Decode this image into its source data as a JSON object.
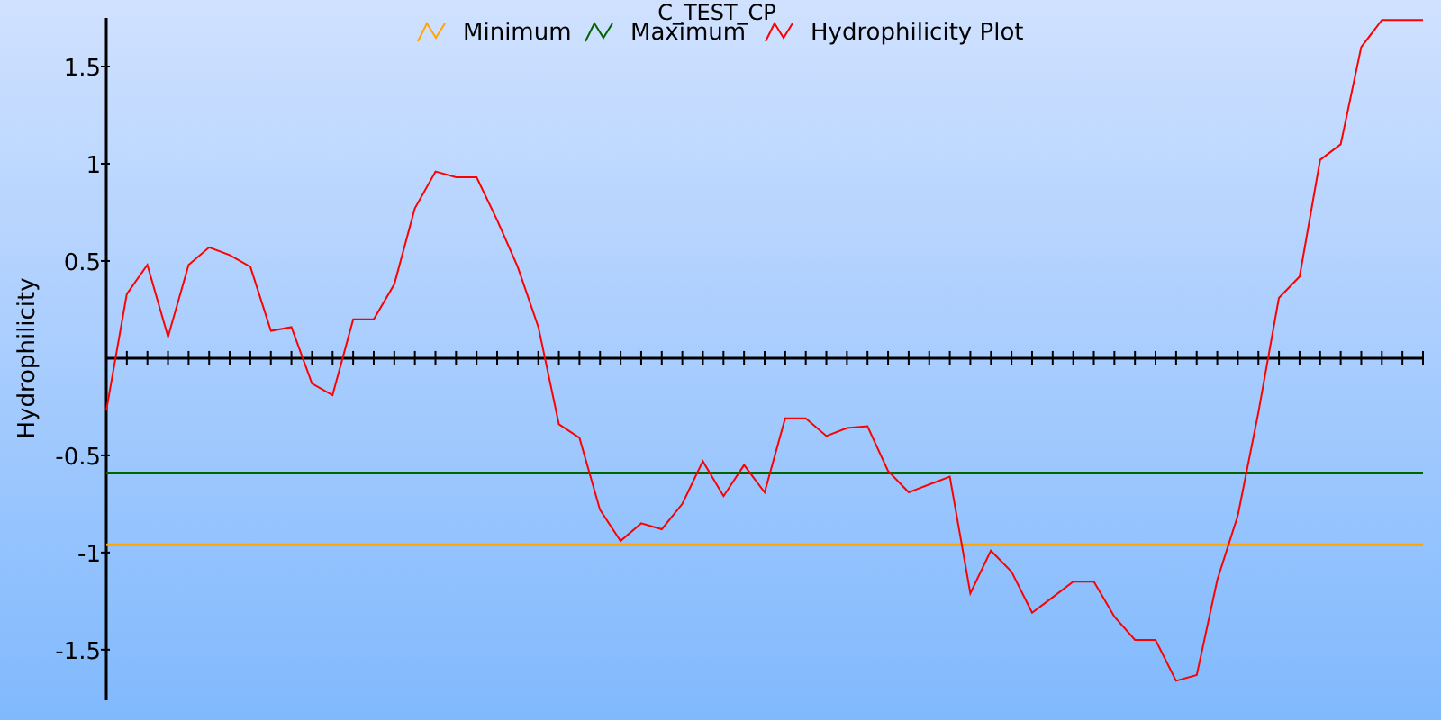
{
  "chart": {
    "chart_data": {
      "type": "line",
      "title": "C_TEST_CP",
      "ylabel": "Hydrophilicity",
      "categories": [
        null,
        null,
        null,
        null,
        null,
        null,
        null,
        null,
        null,
        null,
        null,
        null,
        null,
        null,
        null,
        null,
        null,
        null,
        null,
        null,
        null,
        null,
        null,
        null,
        null,
        null,
        null,
        null,
        null,
        null,
        null,
        null,
        null,
        null,
        null,
        null,
        null,
        null,
        null,
        null,
        null,
        null,
        null,
        null,
        null,
        null,
        null,
        null,
        null,
        null,
        null,
        null,
        null,
        null,
        null,
        null,
        null,
        null,
        null,
        null,
        null,
        null,
        null,
        null,
        null
      ],
      "ylim": [
        -1.76,
        1.75
      ],
      "legend": "top",
      "yticks": [
        {
          "value": -1.5,
          "label": "-1.5"
        },
        {
          "value": -1,
          "label": "-1"
        },
        {
          "value": -0.5,
          "label": "-0.5"
        },
        {
          "value": 0.5,
          "label": "0.5"
        },
        {
          "value": 1,
          "label": "1"
        },
        {
          "value": 1.5,
          "label": "1.5"
        }
      ],
      "series": [
        {
          "name": "Minimum",
          "color": "#ffa500",
          "values": [
            -0.96,
            -0.96,
            -0.96,
            -0.96,
            -0.96,
            -0.96,
            -0.96,
            -0.96,
            -0.96,
            -0.96,
            -0.96,
            -0.96,
            -0.96,
            -0.96,
            -0.96,
            -0.96,
            -0.96,
            -0.96,
            -0.96,
            -0.96,
            -0.96,
            -0.96,
            -0.96,
            -0.96,
            -0.96,
            -0.96,
            -0.96,
            -0.96,
            -0.96,
            -0.96,
            -0.96,
            -0.96,
            -0.96,
            -0.96,
            -0.96,
            -0.96,
            -0.96,
            -0.96,
            -0.96,
            -0.96,
            -0.96,
            -0.96,
            -0.96,
            -0.96,
            -0.96,
            -0.96,
            -0.96,
            -0.96,
            -0.96,
            -0.96,
            -0.96,
            -0.96,
            -0.96,
            -0.96,
            -0.96,
            -0.96,
            -0.96,
            -0.96,
            -0.96,
            -0.96,
            -0.96,
            -0.96,
            -0.96,
            -0.96,
            -0.96
          ]
        },
        {
          "name": "Maximum",
          "color": "#006400",
          "values": [
            -0.59,
            -0.59,
            -0.59,
            -0.59,
            -0.59,
            -0.59,
            -0.59,
            -0.59,
            -0.59,
            -0.59,
            -0.59,
            -0.59,
            -0.59,
            -0.59,
            -0.59,
            -0.59,
            -0.59,
            -0.59,
            -0.59,
            -0.59,
            -0.59,
            -0.59,
            -0.59,
            -0.59,
            -0.59,
            -0.59,
            -0.59,
            -0.59,
            -0.59,
            -0.59,
            -0.59,
            -0.59,
            -0.59,
            -0.59,
            -0.59,
            -0.59,
            -0.59,
            -0.59,
            -0.59,
            -0.59,
            -0.59,
            -0.59,
            -0.59,
            -0.59,
            -0.59,
            -0.59,
            -0.59,
            -0.59,
            -0.59,
            -0.59,
            -0.59,
            -0.59,
            -0.59,
            -0.59,
            -0.59,
            -0.59,
            -0.59,
            -0.59,
            -0.59,
            -0.59,
            -0.59,
            -0.59,
            -0.59,
            -0.59,
            -0.59
          ]
        },
        {
          "name": "Hydrophilicity Plot",
          "color": "#ff0000",
          "values": [
            -0.27,
            0.33,
            0.48,
            0.11,
            0.48,
            0.57,
            0.53,
            0.47,
            0.14,
            0.16,
            -0.13,
            -0.19,
            0.2,
            0.2,
            0.38,
            0.77,
            0.96,
            0.93,
            0.93,
            0.71,
            0.47,
            0.16,
            -0.34,
            -0.41,
            -0.78,
            -0.94,
            -0.85,
            -0.88,
            -0.75,
            -0.53,
            -0.71,
            -0.55,
            -0.69,
            -0.31,
            -0.31,
            -0.4,
            -0.36,
            -0.35,
            -0.58,
            -0.69,
            -0.65,
            -0.61,
            -1.21,
            -0.99,
            -1.1,
            -1.31,
            -1.23,
            -1.15,
            -1.15,
            -1.33,
            -1.45,
            -1.45,
            -1.66,
            -1.63,
            -1.14,
            -0.81,
            -0.28,
            0.31,
            0.42,
            1.02,
            1.1,
            1.6,
            1.74,
            1.74,
            1.74
          ]
        }
      ]
    }
  }
}
